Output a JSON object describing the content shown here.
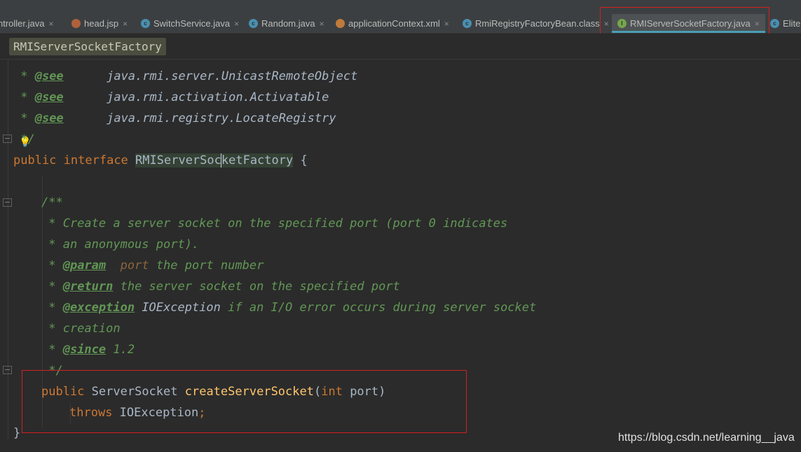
{
  "tabs": [
    {
      "label": "ntroller.java",
      "icon": "java-class-icon",
      "close": "×"
    },
    {
      "label": "head.jsp",
      "icon": "jsp-file-icon",
      "close": "×"
    },
    {
      "label": "SwitchService.java",
      "icon": "java-class-icon",
      "close": "×"
    },
    {
      "label": "Random.java",
      "icon": "java-class-icon",
      "close": "×"
    },
    {
      "label": "applicationContext.xml",
      "icon": "xml-file-icon",
      "close": "×"
    },
    {
      "label": "RmiRegistryFactoryBean.class",
      "icon": "java-class-icon",
      "close": "×"
    },
    {
      "label": "RMIServerSocketFactory.java",
      "icon": "java-interface-icon",
      "close": "×",
      "active": true
    },
    {
      "label": "Elite",
      "icon": "java-class-icon"
    }
  ],
  "breadcrumb": "RMIServerSocketFactory",
  "code": {
    "see_prefix": " * ",
    "see_tag": "@see",
    "see_1": "java.rmi.server.UnicastRemoteObject",
    "see_2": "java.rmi.activation.Activatable",
    "see_3": "java.rmi.registry.LocateRegistry",
    "doc_close": " */",
    "kw_public": "public",
    "kw_interface": "interface",
    "iface_name_a": "RMIServerSoc",
    "iface_name_b": "ketFactory",
    "brace_open": " {",
    "doc_open": "/**",
    "doc_line1": " * Create a server socket on the specified port (port 0 indicates",
    "doc_line2": " * an anonymous port).",
    "star": " * ",
    "param_tag": "@param",
    "param_name": "port",
    "param_desc": " the port number",
    "return_tag": "@return",
    "return_desc": " the server socket on the specified port",
    "exception_tag": "@exception",
    "exception_type": " IOException",
    "exception_desc": " if an I/O error occurs during server socket",
    "creation": " * creation",
    "since_tag": "@since",
    "since_value": " 1.2",
    "doc_end": " */",
    "return_type": "ServerSocket",
    "method_name": "createServerSocket",
    "paren_open": "(",
    "kw_int": "int",
    "arg_name": " port",
    "paren_close": ")",
    "kw_throws": "throws",
    "throws_type": " IOException",
    "semicolon": ";",
    "brace_close": "}"
  },
  "watermark": "https://blog.csdn.net/learning__java",
  "colors": {
    "annotation_box": "#d32020",
    "active_tab_underline": "#4a9fb5"
  }
}
